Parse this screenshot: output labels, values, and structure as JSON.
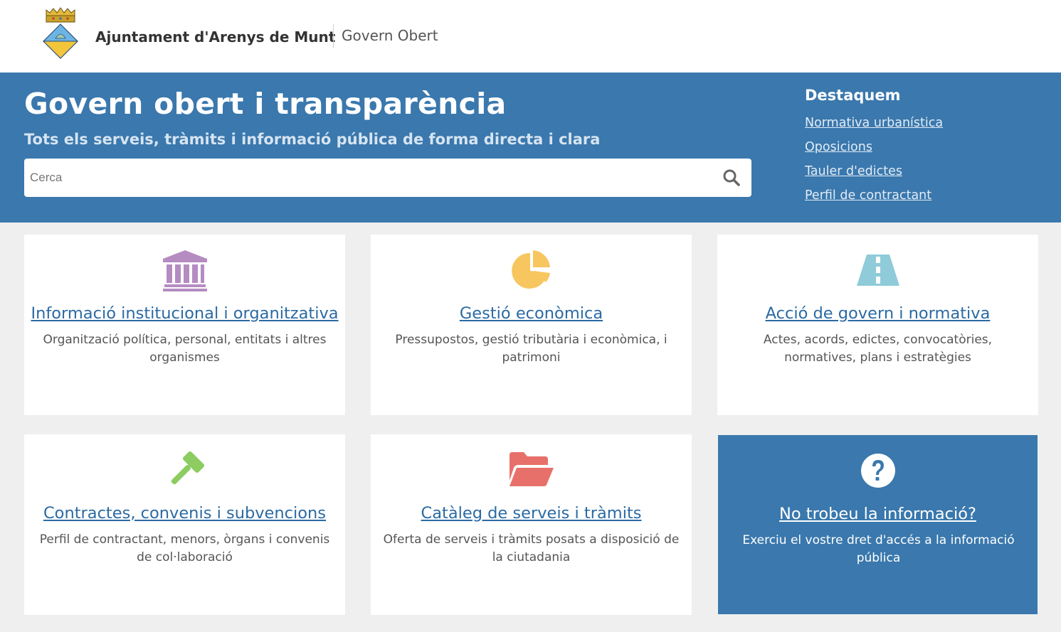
{
  "header": {
    "org_name": "Ajuntament d'Arenys de Munt",
    "site_name": "Govern Obert"
  },
  "hero": {
    "title": "Govern obert i transparència",
    "subtitle": "Tots els serveis, tràmits i informació pública de forma directa i clara",
    "search": {
      "placeholder": "Cerca",
      "value": ""
    }
  },
  "highlights": {
    "title": "Destaquem",
    "links": [
      "Normativa urbanística",
      "Oposicions",
      "Tauler d'edictes",
      "Perfil de contractant"
    ]
  },
  "cards": [
    {
      "icon": "institution-icon",
      "title": "Informació institucional i organitzativa",
      "description": "Organització política, personal, entitats i altres organismes",
      "color": "#b58cc2"
    },
    {
      "icon": "pie-chart-icon",
      "title": "Gestió econòmica",
      "description": "Pressupostos, gestió tributària i econòmica, i patrimoni",
      "color": "#f7c65e"
    },
    {
      "icon": "road-icon",
      "title": "Acció de govern i normativa",
      "description": "Actes, acords, edictes, convocatòries, normatives, plans i estratègies",
      "color": "#8fcbd8"
    },
    {
      "icon": "gavel-icon",
      "title": "Contractes, convenis i subvencions",
      "description": "Perfil de contractant, menors, òrgans i convenis de col·laboració",
      "color": "#8ccc60"
    },
    {
      "icon": "folder-open-icon",
      "title": "Catàleg de serveis i tràmits",
      "description": "Oferta de serveis i tràmits posats a disposició de la ciutadania",
      "color": "#e8706a"
    },
    {
      "icon": "question-circle-icon",
      "title": "No trobeu la informació?",
      "description": "Exerciu el vostre dret d'accés a la informació pública",
      "color": "#ffffff"
    }
  ],
  "colors": {
    "header_bg": "#ffffff",
    "hero_bg": "#3a78ad",
    "page_bg": "#efefef",
    "link": "#2b6aa3"
  }
}
